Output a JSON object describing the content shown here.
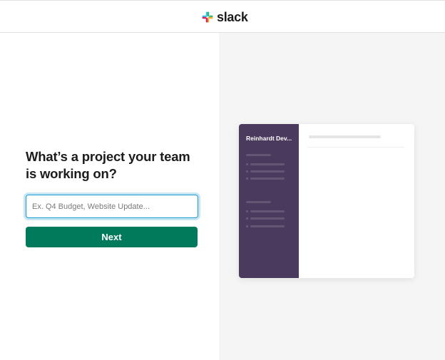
{
  "header": {
    "logo_text": "slack",
    "logo_icon": "slack-logo-icon",
    "brand_colors": [
      "#36c5f0",
      "#2eb67d",
      "#ecb22e",
      "#e01e5a"
    ]
  },
  "form": {
    "heading": "What’s a project your team is working on?",
    "input_placeholder": "Ex. Q4 Budget, Website Update...",
    "input_value": "",
    "next_label": "Next",
    "button_color": "#007a5a"
  },
  "preview": {
    "workspace_name": "Reinhardt Dev...",
    "sidebar_color": "#4a3a5e"
  }
}
